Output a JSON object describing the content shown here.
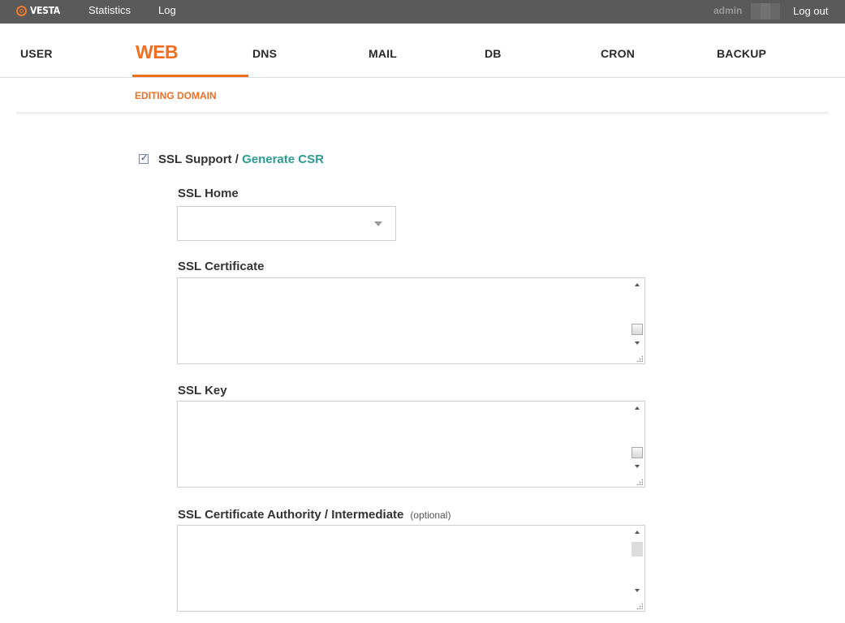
{
  "topbar": {
    "brand": "VESTA",
    "links": [
      "Statistics",
      "Log"
    ],
    "user": "admin",
    "logout": "Log out"
  },
  "nav": {
    "items": [
      "USER",
      "WEB",
      "DNS",
      "MAIL",
      "DB",
      "CRON",
      "BACKUP"
    ],
    "active": "WEB",
    "accent_color": "#f06e22"
  },
  "subnav": {
    "title": "EDITING DOMAIN"
  },
  "form": {
    "ssl_support": {
      "label": "SSL Support /",
      "link": "Generate CSR",
      "checked": true
    },
    "ssl_home": {
      "label": "SSL Home",
      "value": ""
    },
    "ssl_certificate": {
      "label": "SSL Certificate",
      "value": ""
    },
    "ssl_key": {
      "label": "SSL Key",
      "value": ""
    },
    "ssl_ca": {
      "label": "SSL Certificate Authority / Intermediate",
      "optional": "(optional)",
      "value": ""
    }
  },
  "icons": {
    "logo": "vesta-logo-icon",
    "checkbox": "checkmark-icon",
    "dropdown": "chevron-down-icon"
  }
}
